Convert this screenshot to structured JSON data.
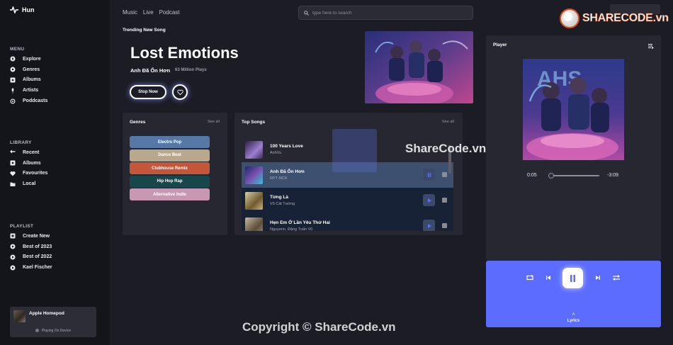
{
  "app": {
    "name": "Hun"
  },
  "sidebar": {
    "menu_title": "MENU",
    "menu": [
      {
        "label": "Explore",
        "icon": "compass-icon"
      },
      {
        "label": "Genres",
        "icon": "disc-icon"
      },
      {
        "label": "Albums",
        "icon": "album-icon"
      },
      {
        "label": "Artists",
        "icon": "microphone-icon"
      },
      {
        "label": "Poddcasts",
        "icon": "podcast-icon"
      }
    ],
    "library_title": "LIBRARY",
    "library": [
      {
        "label": "Recent",
        "icon": "recent-icon"
      },
      {
        "label": "Albums",
        "icon": "album-icon"
      },
      {
        "label": "Favourites",
        "icon": "heart-icon"
      },
      {
        "label": "Local",
        "icon": "folder-icon"
      }
    ],
    "playlist_title": "PLAYLIST",
    "playlist": [
      {
        "label": "Create New",
        "icon": "plus-icon"
      },
      {
        "label": "Best of 2023",
        "icon": "play-circle-icon"
      },
      {
        "label": "Best of 2022",
        "icon": "play-circle-icon"
      },
      {
        "label": "Kael Fischer",
        "icon": "play-circle-icon"
      }
    ],
    "device": {
      "name": "Apple Homepod",
      "status": "Playing On Device"
    }
  },
  "topnav": {
    "links": [
      "Music",
      "Live",
      "Podcast"
    ],
    "search_placeholder": "type here to search"
  },
  "hero": {
    "label": "Trending New Song",
    "title": "Lost Emotions",
    "artist": "Anh Đã Ổn Hơn",
    "plays": "63 Million Plays",
    "stop_label": "Stop Now"
  },
  "genres": {
    "title": "Genres",
    "see_all": "See all",
    "items": [
      {
        "label": "Electro Pop",
        "color": "#5578a6"
      },
      {
        "label": "Dance Beat",
        "color": "#b8a88d"
      },
      {
        "label": "Clubhouse Remix",
        "color": "#c4563a"
      },
      {
        "label": "Hip Hop Rap",
        "color": "#17474a"
      },
      {
        "label": "Alternative Indie",
        "color": "#c898b3"
      }
    ]
  },
  "top_songs": {
    "title": "Top Songs",
    "see_all": "See all",
    "items": [
      {
        "title": "100 Years Love",
        "artist": "AnhVu",
        "bg": "transparent",
        "cover": "linear-gradient(135deg,#2b1f45,#9d7fd0 60%,#3a2c5c)",
        "state": "none"
      },
      {
        "title": "Anh Đã Ổn Hơn",
        "artist": "RPT MCK",
        "bg": "#3e506f",
        "cover": "linear-gradient(135deg,#1a2a6c,#7b4fb0 50%,#2ec5d8)",
        "state": "pause"
      },
      {
        "title": "Từng Là",
        "artist": "Vũ Cát Tường",
        "bg": "#182236",
        "cover": "linear-gradient(135deg,#d9cfa1,#6e5a2e 60%,#c6b682)",
        "state": "play"
      },
      {
        "title": "Hẹn Em Ở Lần Yêu Thứ Hai",
        "artist": "Nguyenn, Đặng Tuấn Vũ",
        "bg": "#182236",
        "cover": "linear-gradient(135deg,#c6b9a0,#5c4e3a 60%,#9b8a70)",
        "state": "play"
      }
    ]
  },
  "player": {
    "title": "Player",
    "current_time": "0:05",
    "remaining_time": "-3:09",
    "progress_fraction": 0.03,
    "lyrics_label": "Lyrics"
  },
  "watermarks": {
    "logo_text": "SHARECODE.vn",
    "middle": "ShareCode.vn",
    "bottom": "Copyright © ShareCode.vn"
  },
  "colors": {
    "accent": "#5b6cff",
    "panel": "#262730",
    "background": "#1b1c24",
    "sidebar": "#14151b"
  }
}
